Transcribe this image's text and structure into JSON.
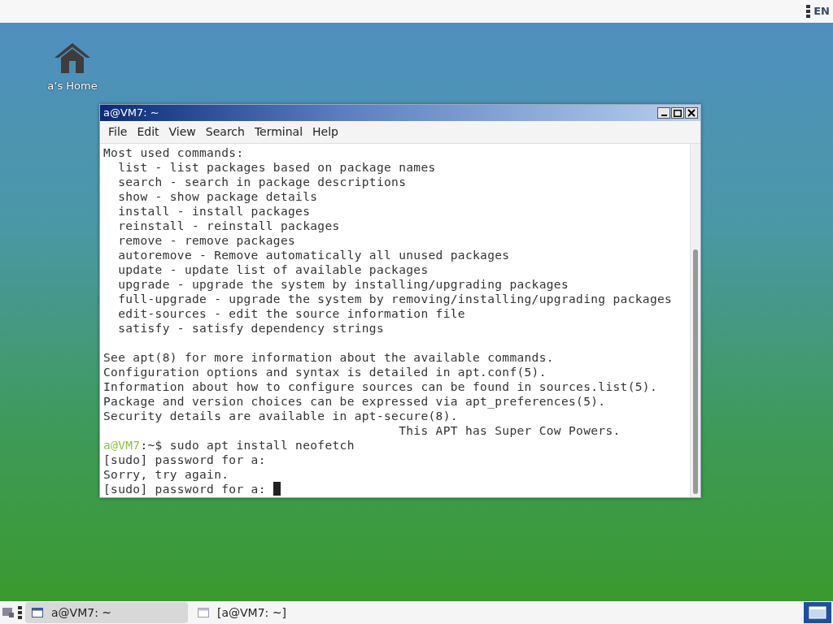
{
  "top_panel": {
    "keyboard_layout": "EN"
  },
  "desktop_icons": [
    {
      "label": "a’s Home"
    }
  ],
  "window": {
    "title": "a@VM7: ~",
    "active": true,
    "menu": [
      "File",
      "Edit",
      "View",
      "Search",
      "Terminal",
      "Help"
    ],
    "lines": [
      {
        "kind": "output",
        "text": "Most used commands:"
      },
      {
        "kind": "output",
        "text": "  list - list packages based on package names"
      },
      {
        "kind": "output",
        "text": "  search - search in package descriptions"
      },
      {
        "kind": "output",
        "text": "  show - show package details"
      },
      {
        "kind": "output",
        "text": "  install - install packages"
      },
      {
        "kind": "output",
        "text": "  reinstall - reinstall packages"
      },
      {
        "kind": "output",
        "text": "  remove - remove packages"
      },
      {
        "kind": "output",
        "text": "  autoremove - Remove automatically all unused packages"
      },
      {
        "kind": "output",
        "text": "  update - update list of available packages"
      },
      {
        "kind": "output",
        "text": "  upgrade - upgrade the system by installing/upgrading packages"
      },
      {
        "kind": "output",
        "text": "  full-upgrade - upgrade the system by removing/installing/upgrading packages"
      },
      {
        "kind": "output",
        "text": "  edit-sources - edit the source information file"
      },
      {
        "kind": "output",
        "text": "  satisfy - satisfy dependency strings"
      },
      {
        "kind": "blank"
      },
      {
        "kind": "output",
        "text": "See apt(8) for more information about the available commands."
      },
      {
        "kind": "output",
        "text": "Configuration options and syntax is detailed in apt.conf(5)."
      },
      {
        "kind": "output",
        "text": "Information about how to configure sources can be found in sources.list(5)."
      },
      {
        "kind": "output",
        "text": "Package and version choices can be expressed via apt_preferences(5)."
      },
      {
        "kind": "output",
        "text": "Security details are available in apt-secure(8)."
      },
      {
        "kind": "output",
        "text": "                                        This APT has Super Cow Powers."
      },
      {
        "kind": "prompt",
        "host": "a@VM7",
        "text": ":~$ sudo apt install neofetch"
      },
      {
        "kind": "output",
        "text": "[sudo] password for a:"
      },
      {
        "kind": "output",
        "text": "Sorry, try again."
      },
      {
        "kind": "output",
        "text": "[sudo] password for a: ",
        "cursor": true
      }
    ]
  },
  "taskbar": {
    "tasks": [
      {
        "label": "a@VM7: ~",
        "selected": true
      },
      {
        "label": "[a@VM7: ~]",
        "selected": false
      }
    ]
  }
}
